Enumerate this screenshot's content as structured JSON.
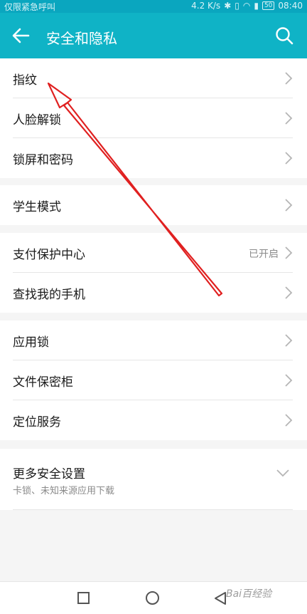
{
  "status_bar": {
    "carrier": "仅限紧急呼叫",
    "speed": "4.2 K/s",
    "battery": "50",
    "time": "08:40"
  },
  "app_bar": {
    "title": "安全和隐私"
  },
  "groups": [
    {
      "items": [
        {
          "label": "指纹"
        },
        {
          "label": "人脸解锁"
        },
        {
          "label": "锁屏和密码"
        }
      ]
    },
    {
      "items": [
        {
          "label": "学生模式"
        }
      ]
    },
    {
      "items": [
        {
          "label": "支付保护中心",
          "value": "已开启"
        },
        {
          "label": "查找我的手机"
        }
      ]
    },
    {
      "items": [
        {
          "label": "应用锁"
        },
        {
          "label": "文件保密柜"
        },
        {
          "label": "定位服务"
        }
      ]
    },
    {
      "items": [
        {
          "label": "更多安全设置",
          "sublabel": "卡锁、未知来源应用下载"
        }
      ]
    }
  ],
  "watermark": "Bai百经验",
  "colors": {
    "app_bar": "#0fb3c6",
    "status_bar": "#0aa6bf",
    "annotation_arrow": "#e02020"
  }
}
